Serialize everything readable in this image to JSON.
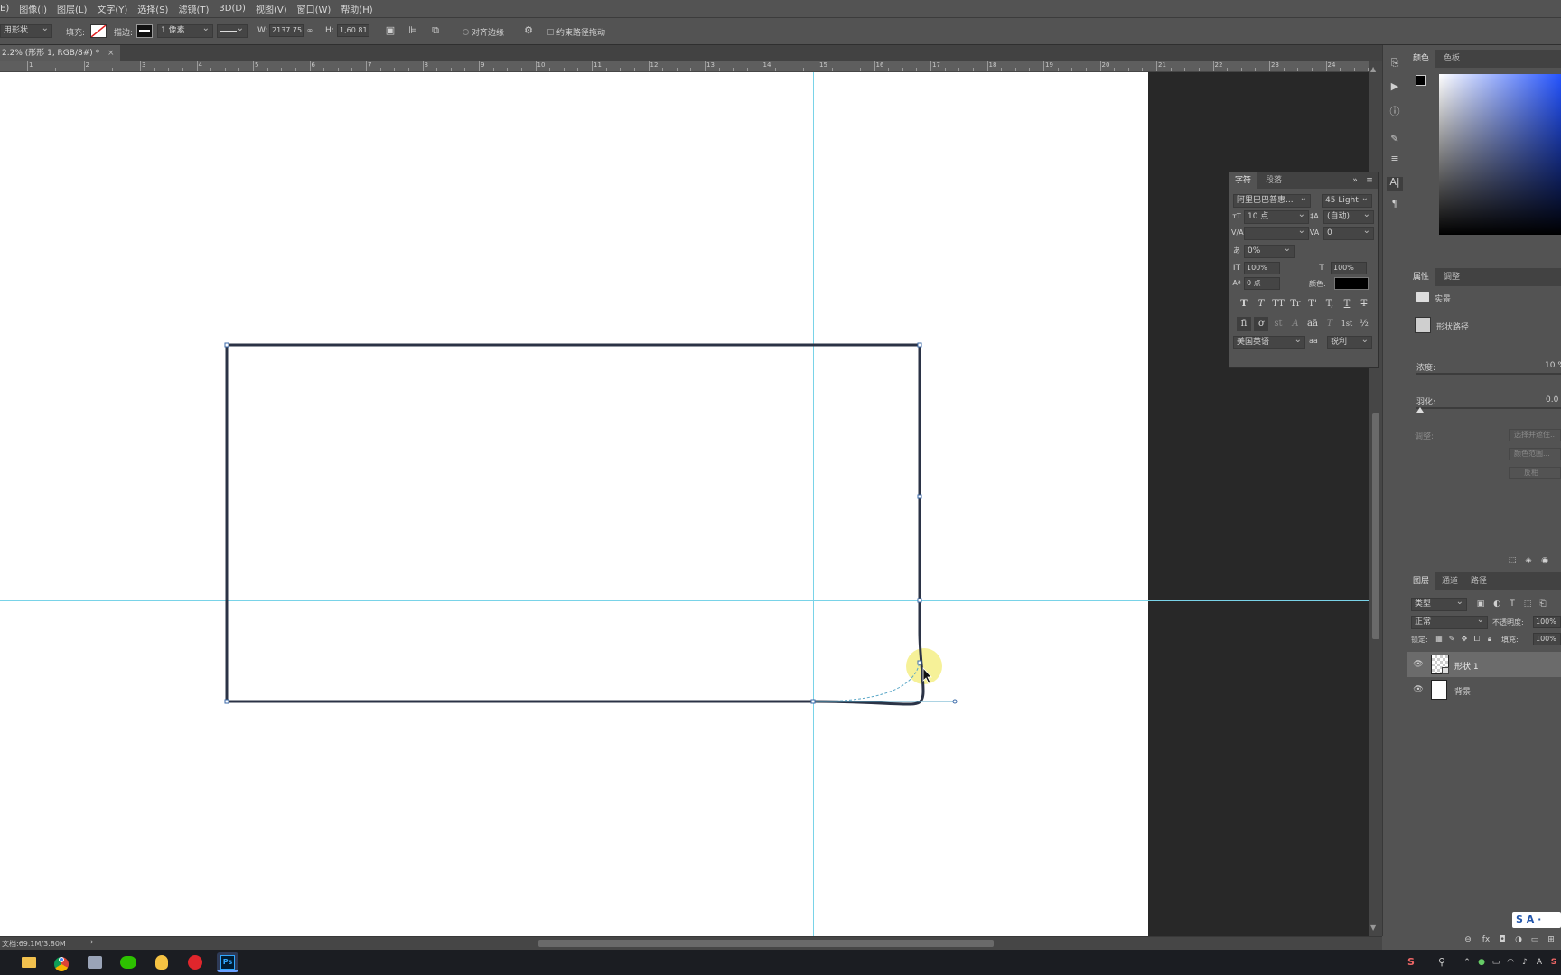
{
  "menu": [
    "E)",
    "图像(I)",
    "图层(L)",
    "文字(Y)",
    "选择(S)",
    "滤镜(T)",
    "3D(D)",
    "视图(V)",
    "窗口(W)",
    "帮助(H)"
  ],
  "options": {
    "mode": "用形状",
    "fill_label": "填充:",
    "stroke_label": "描边:",
    "stroke_width": "1 像素",
    "w_label": "W:",
    "w_value": "2137.75",
    "h_label": "H:",
    "h_value": "1,60.81",
    "align_edges": "对齐边缘",
    "constrain": "约束路径拖动"
  },
  "doc_tab": {
    "title": "2.2% (形形 1, RGB/8#) *",
    "close": "×"
  },
  "ruler_numbers": [
    "1",
    "2",
    "3",
    "4",
    "5",
    "6",
    "7",
    "8",
    "9",
    "10",
    "11",
    "12",
    "13",
    "14",
    "15",
    "16",
    "17",
    "18",
    "19",
    "20",
    "21",
    "22",
    "23",
    "24"
  ],
  "status": {
    "doc_info": "文档:69.1M/3.80M",
    "arrow": "›"
  },
  "color_panel": {
    "tabs": [
      "颜色",
      "色板"
    ]
  },
  "character_panel": {
    "tabs": [
      "字符",
      "段落"
    ],
    "font_family": "阿里巴巴普惠...",
    "font_style": "45 Light",
    "font_size": "10 点",
    "leading": "(自动)",
    "kerning": "",
    "tracking": "0",
    "scale_pct": "0%",
    "vscale": "100%",
    "hscale": "100%",
    "baseline": "0 点",
    "color_label": "颜色:",
    "language": "美国英语",
    "aa_label": "aa",
    "aa_mode": "锐利",
    "type_buttons": [
      "T",
      "T",
      "TT",
      "Tr",
      "T'",
      "T,",
      "T",
      "T"
    ],
    "opentype_buttons": [
      "fi",
      "ơ",
      "st",
      "A",
      "aā",
      "T",
      "1st",
      "½"
    ]
  },
  "properties_panel": {
    "tabs": [
      "属性",
      "调整"
    ],
    "kind": "实景",
    "shape_label": "形状路径",
    "feather_label": "浓度:",
    "feather_value": "10.%",
    "feather2_label": "羽化:",
    "feather2_value": "0.0",
    "refine_label": "调整:",
    "buttons": [
      "选择并遮住...",
      "颜色范围...",
      "反相"
    ],
    "density_pct": 1.0,
    "feather_pct": 0.0
  },
  "layers_panel": {
    "tabs": [
      "图层",
      "通道",
      "路径"
    ],
    "filter_kind": "类型",
    "blend_mode": "正常",
    "opacity_label": "不透明度:",
    "opacity_value": "100%",
    "lock_label": "锁定:",
    "fill_label": "填充:",
    "fill_value": "100%",
    "layers": [
      {
        "name": "形状 1",
        "selected": true
      },
      {
        "name": "背景",
        "selected": false
      }
    ]
  },
  "ime": {
    "label": "S A ·"
  },
  "colors": {
    "ui_bg": "#535353",
    "guide": "#79d3e8",
    "path": "#2b3346",
    "cursor_highlight": "#f4ef86"
  }
}
